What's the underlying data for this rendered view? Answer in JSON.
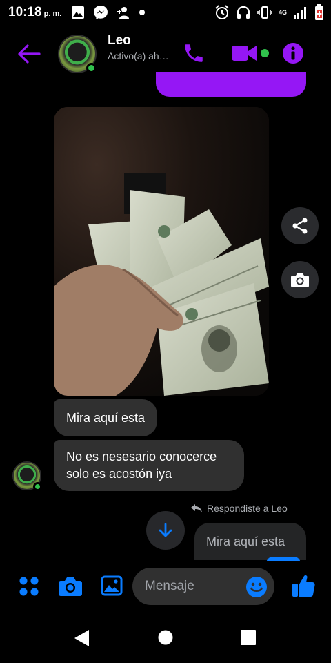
{
  "status_bar": {
    "time": "10:18",
    "ampm": "p. m.",
    "network": "4G"
  },
  "header": {
    "contact_name": "Leo",
    "presence": "Activo(a) ahora",
    "accent_color": "#9517f5",
    "online_color": "#31c24d"
  },
  "messages": [
    {
      "from": "contact",
      "text": "Mira aquí esta"
    },
    {
      "from": "contact",
      "text": "No es nesesario conocerce solo es acostón iya"
    }
  ],
  "reply_note": "Respondiste a Leo",
  "reply_quote": "Mira aquí esta",
  "composer": {
    "placeholder": "Mensaje",
    "accent_color": "#0a7cff"
  }
}
